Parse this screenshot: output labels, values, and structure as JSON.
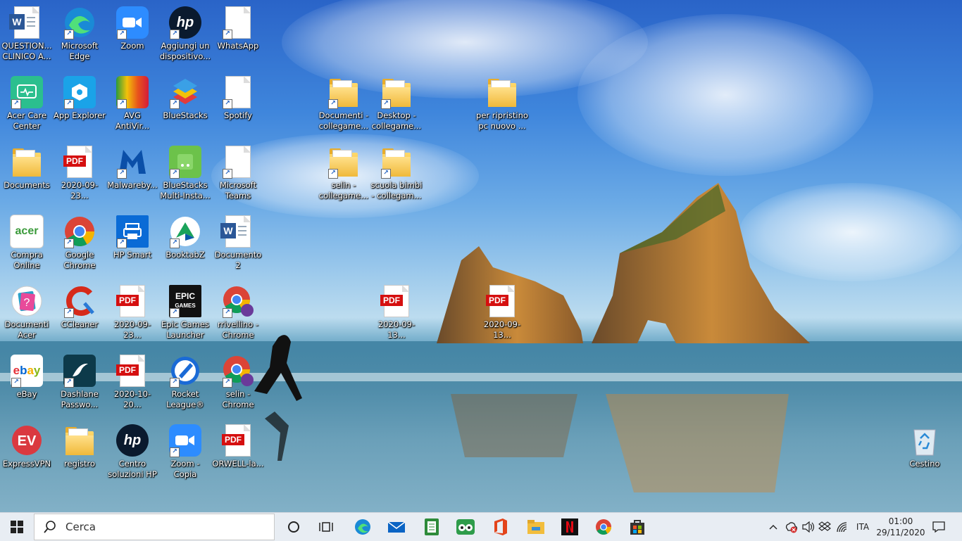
{
  "desktop_icons": [
    {
      "label": "QUESTION... CLINICO A...",
      "icon": "word-document-icon"
    },
    {
      "label": "Microsoft Edge",
      "icon": "edge-icon"
    },
    {
      "label": "Zoom",
      "icon": "zoom-icon"
    },
    {
      "label": "Aggiungi un dispositivo...",
      "icon": "hp-icon"
    },
    {
      "label": "WhatsApp",
      "icon": "blank-file-icon"
    },
    {
      "label": "Acer Care Center",
      "icon": "acer-care-icon"
    },
    {
      "label": "App Explorer",
      "icon": "app-explorer-icon"
    },
    {
      "label": "AVG AntiVir...",
      "icon": "avg-icon"
    },
    {
      "label": "BlueStacks",
      "icon": "bluestacks-icon"
    },
    {
      "label": "Spotify",
      "icon": "blank-file-icon"
    },
    {
      "label": "Documents",
      "icon": "folder-icon"
    },
    {
      "label": "2020-09-23...",
      "icon": "pdf-icon"
    },
    {
      "label": "Malwareby...",
      "icon": "malwarebytes-icon"
    },
    {
      "label": "BlueStacks Multi-Insta...",
      "icon": "bluestacks-multi-icon"
    },
    {
      "label": "Microsoft Teams",
      "icon": "blank-file-icon"
    },
    {
      "label": "Compra Online",
      "icon": "acer-shop-icon"
    },
    {
      "label": "Google Chrome",
      "icon": "chrome-icon"
    },
    {
      "label": "HP Smart",
      "icon": "hp-smart-icon"
    },
    {
      "label": "BooktabZ",
      "icon": "booktabz-icon"
    },
    {
      "label": "Documento 2",
      "icon": "word-document-icon"
    },
    {
      "label": "Documenti Acer",
      "icon": "documenti-acer-icon"
    },
    {
      "label": "CCleaner",
      "icon": "ccleaner-icon"
    },
    {
      "label": "2020-09-23...",
      "icon": "pdf-icon"
    },
    {
      "label": "Epic Games Launcher",
      "icon": "epic-games-icon"
    },
    {
      "label": "rrivellino - Chrome",
      "icon": "chrome-profile-icon"
    },
    {
      "label": "eBay",
      "icon": "ebay-icon"
    },
    {
      "label": "Dashlane Passwo...",
      "icon": "dashlane-icon"
    },
    {
      "label": "2020-10-20...",
      "icon": "pdf-icon"
    },
    {
      "label": "Rocket League®",
      "icon": "rocket-league-icon"
    },
    {
      "label": "selin - Chrome",
      "icon": "chrome-profile-icon"
    },
    {
      "label": "ExpressVPN",
      "icon": "expressvpn-icon"
    },
    {
      "label": "registro",
      "icon": "folder-icon"
    },
    {
      "label": "Centro soluzioni HP",
      "icon": "hp-icon"
    },
    {
      "label": "Zoom - Copia",
      "icon": "zoom-icon"
    },
    {
      "label": "ORWELL-la...",
      "icon": "pdf-icon"
    },
    {
      "label": "Documenti - collegame...",
      "icon": "folder-icon"
    },
    {
      "label": "Desktop - collegame...",
      "icon": "folder-icon"
    },
    {
      "label": "per ripristino pc nuovo ...",
      "icon": "folder-icon"
    },
    {
      "label": "selin - collegame...",
      "icon": "folder-icon"
    },
    {
      "label": "scuola bimbi - collegam...",
      "icon": "folder-icon"
    },
    {
      "label": "2020-09-13...",
      "icon": "pdf-icon"
    },
    {
      "label": "2020-09-13...",
      "icon": "pdf-icon"
    },
    {
      "label": "Cestino",
      "icon": "recycle-bin-icon"
    }
  ],
  "taskbar": {
    "search_placeholder": "Cerca",
    "pinned": [
      "task-view-icon",
      "edge-icon",
      "mail-icon",
      "notes-icon",
      "tripadvisor-icon",
      "office-icon",
      "file-explorer-icon",
      "netflix-icon",
      "chrome-icon",
      "store-icon"
    ],
    "language": "ITA",
    "time": "01:00",
    "date": "29/11/2020"
  },
  "colors": {
    "taskbar_bg": "#e8edf3",
    "pdf_red": "#d50f0f",
    "folder_yellow": "#f0b93a"
  }
}
